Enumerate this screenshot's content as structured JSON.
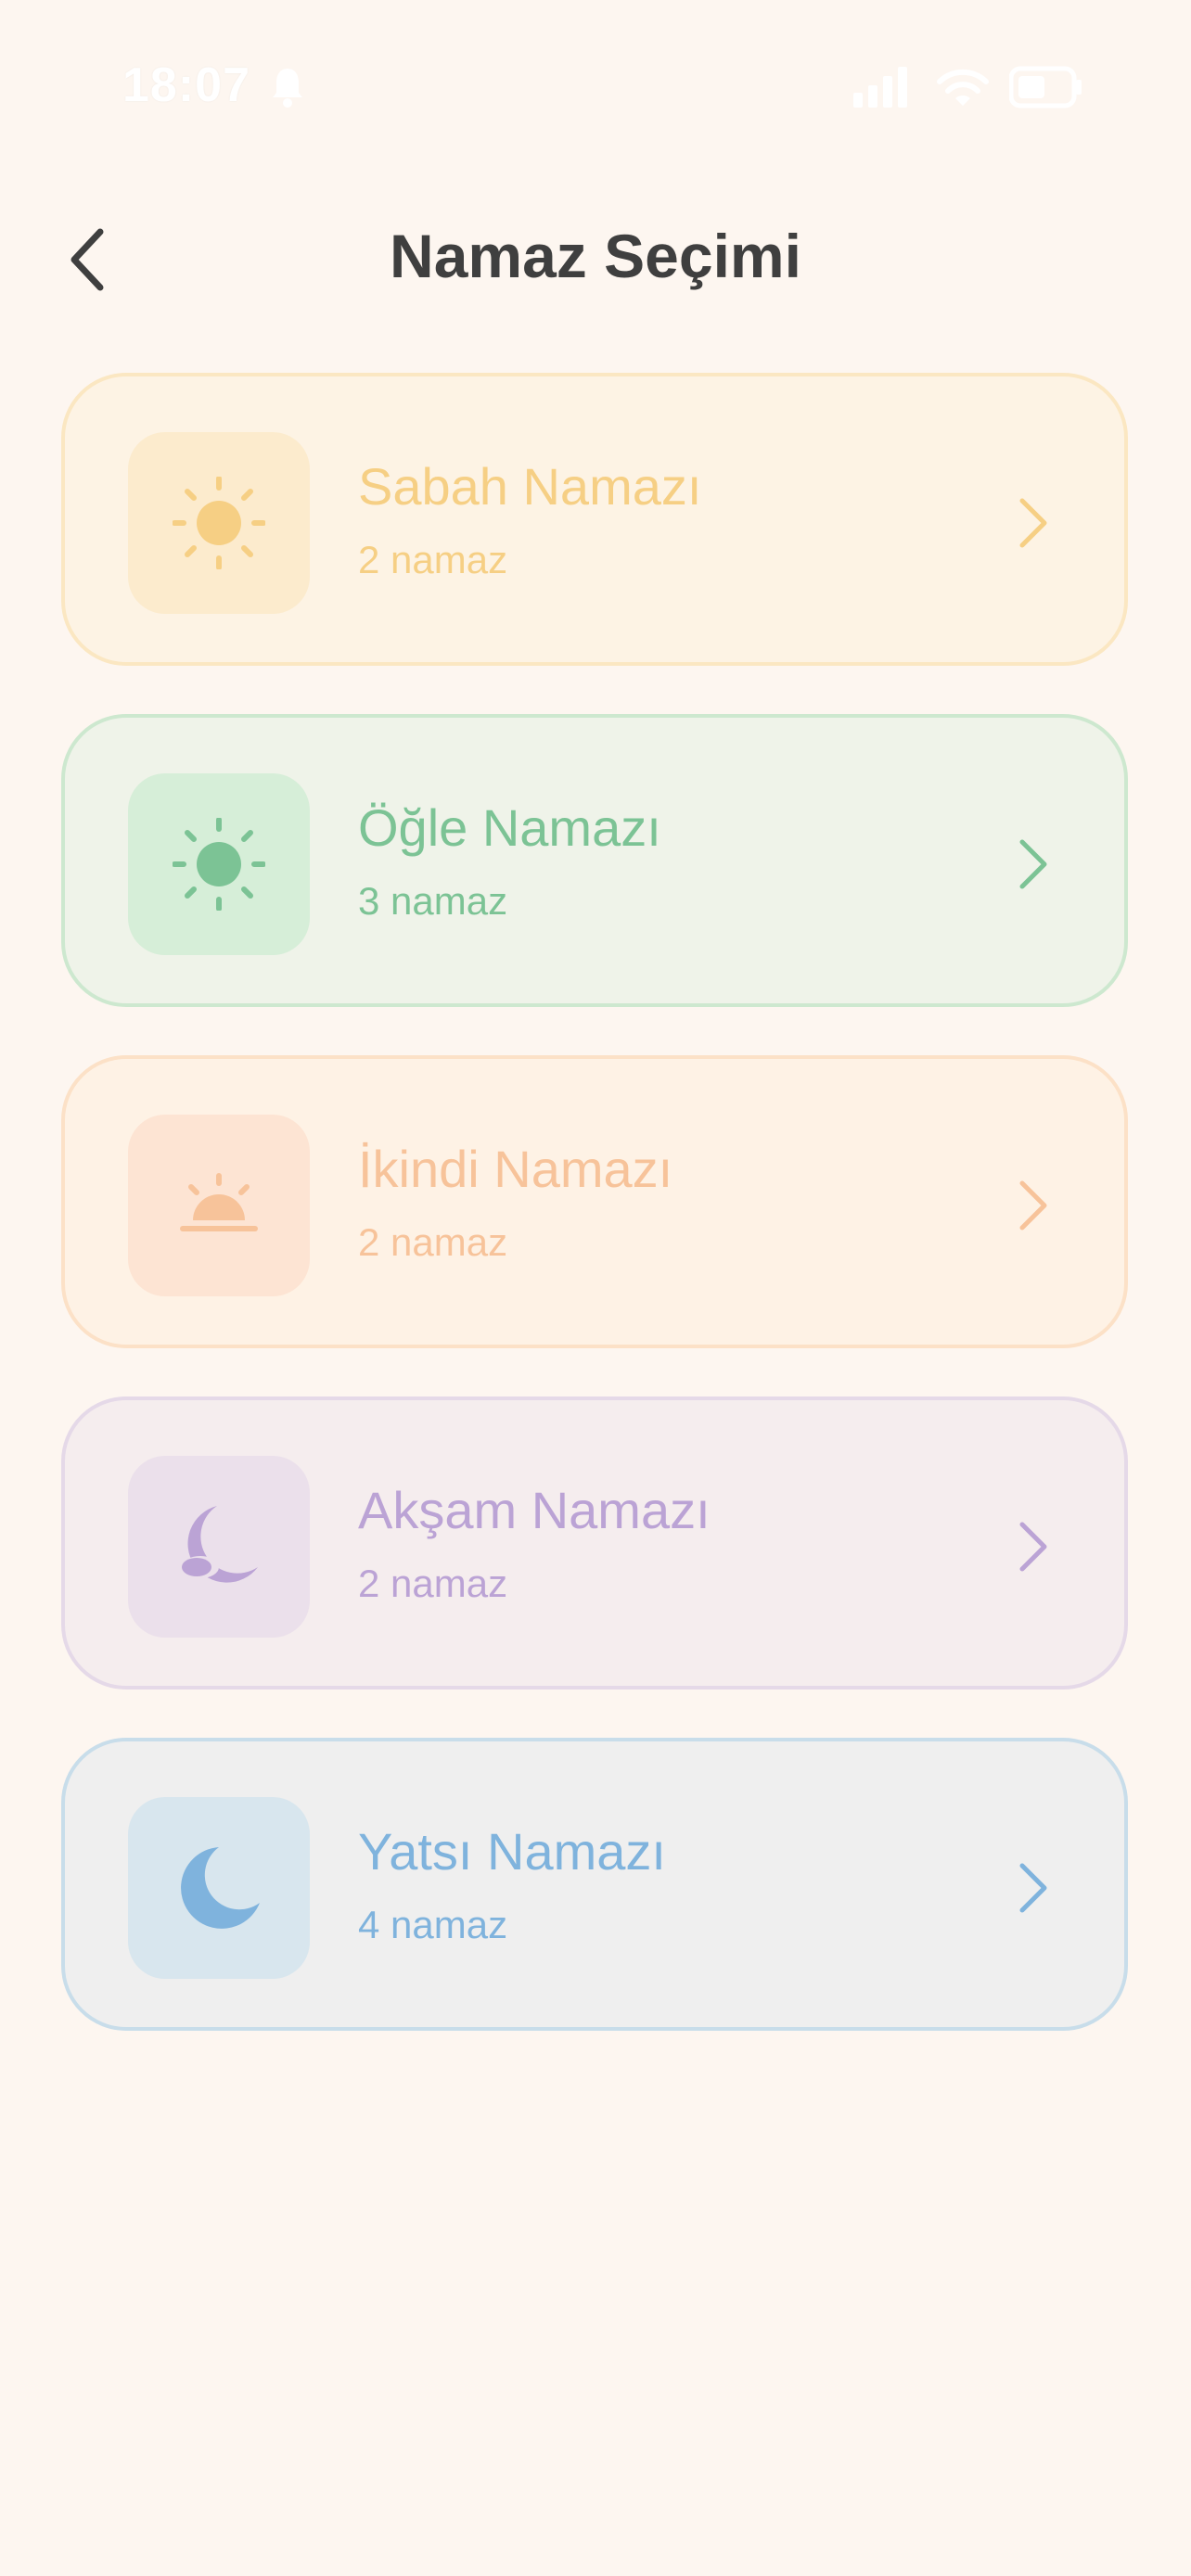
{
  "status_bar": {
    "time": "18:07"
  },
  "header": {
    "title": "Namaz Seçimi"
  },
  "prayers": [
    {
      "title": "Sabah Namazı",
      "subtitle": "2 namaz",
      "icon": "sun-icon",
      "color": "#F6CF84"
    },
    {
      "title": "Öğle Namazı",
      "subtitle": "3 namaz",
      "icon": "sun-icon",
      "color": "#7CC395"
    },
    {
      "title": "İkindi Namazı",
      "subtitle": "2 namaz",
      "icon": "sunset-icon",
      "color": "#F7C39A"
    },
    {
      "title": "Akşam Namazı",
      "subtitle": "2 namaz",
      "icon": "moon-cloud-icon",
      "color": "#BBA3D5"
    },
    {
      "title": "Yatsı Namazı",
      "subtitle": "4 namaz",
      "icon": "moon-icon",
      "color": "#7FB3DD"
    }
  ]
}
